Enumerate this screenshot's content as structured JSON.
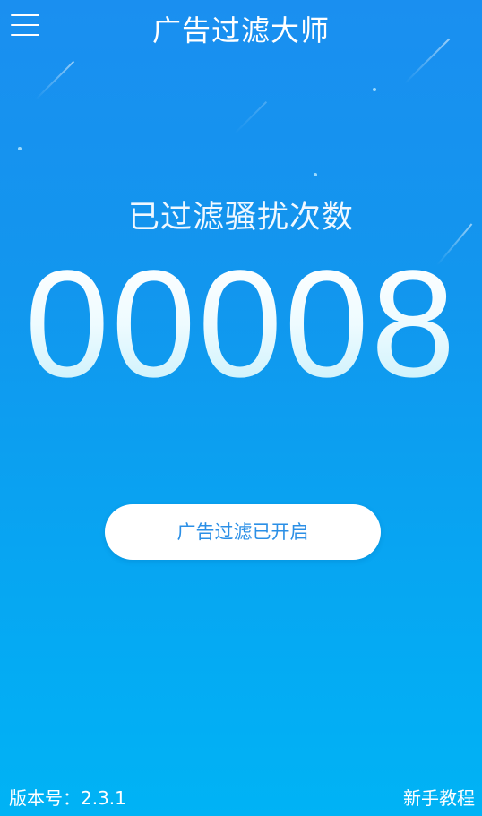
{
  "header": {
    "title": "广告过滤大师",
    "menu_icon": "hamburger-menu-icon"
  },
  "counter": {
    "label": "已过滤骚扰次数",
    "value": "00008"
  },
  "status_button": {
    "label": "广告过滤已开启"
  },
  "footer": {
    "version_label": "版本号：2.3.1",
    "tutorial_label": "新手教程"
  },
  "colors": {
    "background_top": "#1a8ff0",
    "background_bottom": "#00b3f5",
    "button_text": "#2b8fe6"
  }
}
